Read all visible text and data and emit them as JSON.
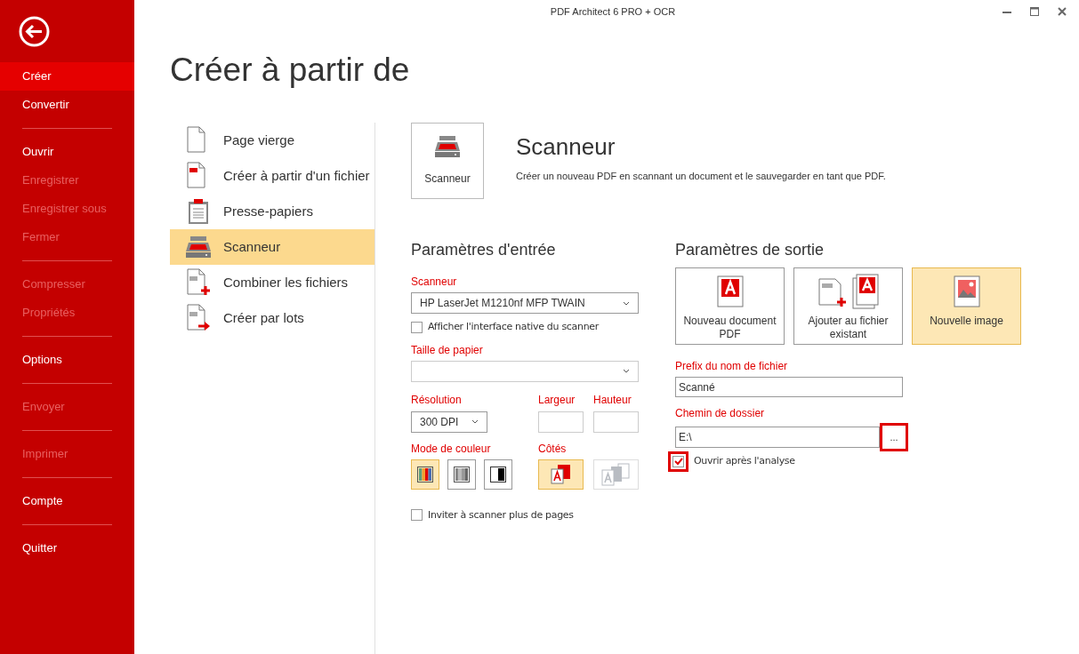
{
  "window": {
    "title": "PDF Architect 6 PRO + OCR"
  },
  "sidebar": {
    "items": [
      {
        "kind": "item",
        "label": "Créer",
        "selected": true,
        "disabled": false
      },
      {
        "kind": "item",
        "label": "Convertir",
        "selected": false,
        "disabled": false
      },
      {
        "kind": "separator"
      },
      {
        "kind": "item",
        "label": "Ouvrir",
        "selected": false,
        "disabled": false
      },
      {
        "kind": "item",
        "label": "Enregistrer",
        "selected": false,
        "disabled": true
      },
      {
        "kind": "item",
        "label": "Enregistrer sous",
        "selected": false,
        "disabled": true
      },
      {
        "kind": "item",
        "label": "Fermer",
        "selected": false,
        "disabled": true
      },
      {
        "kind": "separator"
      },
      {
        "kind": "item",
        "label": "Compresser",
        "selected": false,
        "disabled": true
      },
      {
        "kind": "item",
        "label": "Propriétés",
        "selected": false,
        "disabled": true
      },
      {
        "kind": "separator"
      },
      {
        "kind": "item",
        "label": "Options",
        "selected": false,
        "disabled": false
      },
      {
        "kind": "separator"
      },
      {
        "kind": "item",
        "label": "Envoyer",
        "selected": false,
        "disabled": true
      },
      {
        "kind": "separator"
      },
      {
        "kind": "item",
        "label": "Imprimer",
        "selected": false,
        "disabled": true
      },
      {
        "kind": "separator"
      },
      {
        "kind": "item",
        "label": "Compte",
        "selected": false,
        "disabled": false
      },
      {
        "kind": "separator"
      },
      {
        "kind": "item",
        "label": "Quitter",
        "selected": false,
        "disabled": false
      }
    ]
  },
  "page_title": "Créer à partir de",
  "sources": [
    {
      "kind": "blank",
      "label": "Page vierge",
      "selected": false
    },
    {
      "kind": "file",
      "label": "Créer à partir d'un fichier",
      "selected": false
    },
    {
      "kind": "clipboard",
      "label": "Presse-papiers",
      "selected": false
    },
    {
      "kind": "scanner",
      "label": "Scanneur",
      "selected": true
    },
    {
      "kind": "combine",
      "label": "Combiner les fichiers",
      "selected": false
    },
    {
      "kind": "batch",
      "label": "Créer par lots",
      "selected": false
    }
  ],
  "detail": {
    "tile_label": "Scanneur",
    "heading": "Scanneur",
    "description": "Créer un nouveau PDF en scannant un document et le sauvegarder en tant que PDF."
  },
  "input": {
    "heading": "Paramètres d'entrée",
    "scanner_label": "Scanneur",
    "scanner_value": "HP LaserJet M1210nf MFP TWAIN",
    "native_ui": {
      "label": "Afficher l'interface native du scanner",
      "checked": false
    },
    "paper_label": "Taille de papier",
    "resolution_label": "Résolution",
    "resolution_value": "300 DPI",
    "width_label": "Largeur",
    "height_label": "Hauteur",
    "color_label": "Mode de couleur",
    "color_modes": [
      {
        "kind": "color",
        "selected": true
      },
      {
        "kind": "gray",
        "selected": false
      },
      {
        "kind": "bw",
        "selected": false
      }
    ],
    "sides_label": "Côtés",
    "sides": [
      {
        "kind": "simplex",
        "selected": true,
        "disabled": false
      },
      {
        "kind": "duplex",
        "selected": false,
        "disabled": true
      }
    ],
    "more_pages": {
      "label": "Inviter à scanner plus de pages",
      "checked": false
    }
  },
  "output": {
    "heading": "Paramètres de sortie",
    "targets": [
      {
        "kind": "new_pdf",
        "label": "Nouveau document PDF",
        "selected": false
      },
      {
        "kind": "append",
        "label": "Ajouter au fichier existant",
        "selected": false
      },
      {
        "kind": "image",
        "label": "Nouvelle image",
        "selected": true
      }
    ],
    "prefix_label": "Prefix du nom de fichier",
    "prefix_value": "Scanné",
    "folder_label": "Chemin de dossier",
    "folder_value": "E:\\",
    "browse": {
      "label": "...",
      "highlighted": true
    },
    "open_after": {
      "label": "Ouvrir après l'analyse",
      "checked": true,
      "highlighted": true
    }
  }
}
